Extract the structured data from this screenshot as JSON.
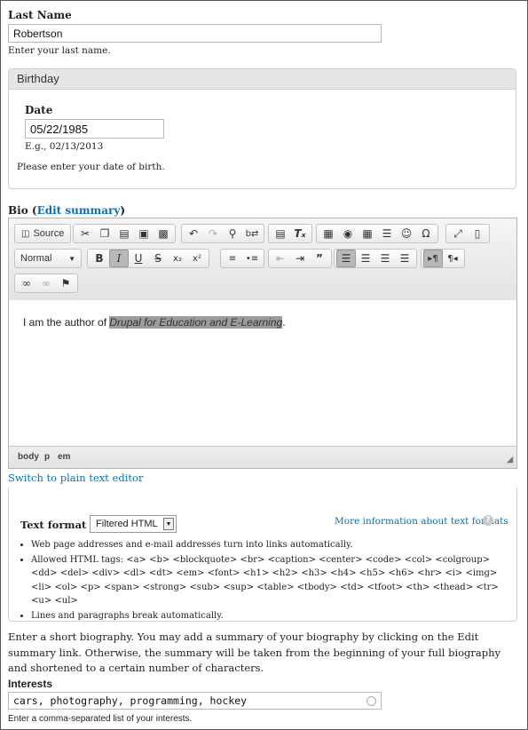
{
  "last_name": {
    "label": "Last Name",
    "value": "Robertson",
    "description": "Enter your last name."
  },
  "birthday": {
    "legend": "Birthday",
    "date_label": "Date",
    "date_value": "05/22/1985",
    "example": "E.g., 02/13/2013",
    "description": "Please enter your date of birth."
  },
  "bio": {
    "label_prefix": "Bio (",
    "edit_summary_link": "Edit summary",
    "label_suffix": ")",
    "toolbar": {
      "source_label": "Source",
      "format_combo": "Normal"
    },
    "content_prefix": "I am the author of ",
    "content_italic": "Drupal for Education and E-Learning",
    "content_suffix": ".",
    "path": [
      "body",
      "p",
      "em"
    ],
    "switch_link": "Switch to plain text editor",
    "text_format_label": "Text format",
    "text_format_value": "Filtered HTML",
    "more_info_link": "More information about text formats",
    "tips": [
      "Web page addresses and e-mail addresses turn into links automatically.",
      "Allowed HTML tags: <a> <b> <blockquote> <br> <caption> <center> <code> <col> <colgroup> <dd> <del> <div> <dl> <dt> <em> <font> <h1> <h2> <h3> <h4> <h5> <h6> <hr> <i> <img> <li> <ol> <p> <span> <strong> <sub> <sup> <table> <tbody> <td> <tfoot> <th> <thead> <tr> <u> <ul>",
      "Lines and paragraphs break automatically."
    ],
    "description": "Enter a short biography. You may add a summary of your biography by clicking on the Edit summary link. Otherwise, the summary will be taken from the beginning of your full biography and shortened to a certain number of characters."
  },
  "interests": {
    "label": "Interests",
    "value": "cars, photography, programming, hockey",
    "description": "Enter a comma-separated list of your interests."
  }
}
